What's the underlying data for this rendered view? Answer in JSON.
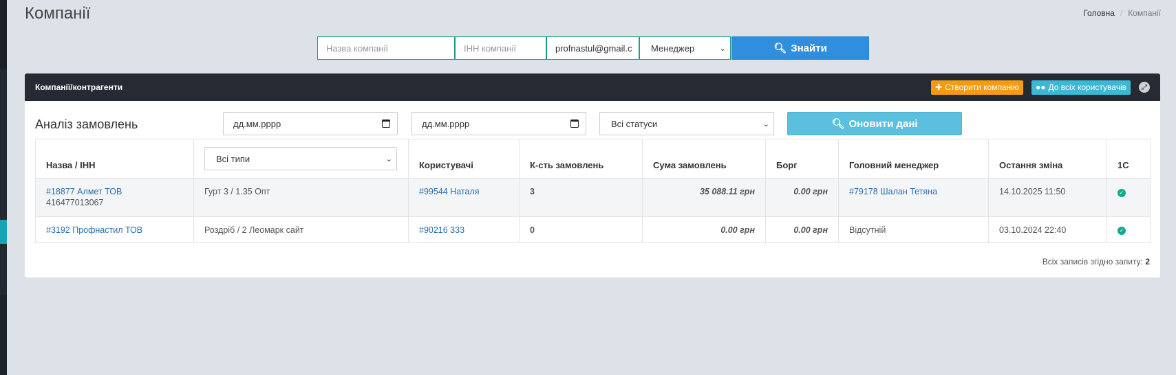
{
  "page": {
    "title": "Компанії"
  },
  "breadcrumb": {
    "home": "Головна",
    "separator": "/",
    "current": "Компанії"
  },
  "search": {
    "name_placeholder": "Назва компанії",
    "inn_placeholder": "ІНН компанії",
    "email_value": "profnastul@gmail.c",
    "manager_selected": "Менеджер",
    "find_label": "Знайти"
  },
  "panel": {
    "title": "Компанії/контрагенти",
    "create_label": "Створити компанію",
    "users_label": "До всіх користувачів"
  },
  "analysis": {
    "title": "Аналіз замовлень",
    "date_from_placeholder": "дд.мм.рррр",
    "date_to_placeholder": "дд.мм.рррр",
    "status_selected": "Всі статуси",
    "refresh_label": "Оновити дані",
    "type_selected": "Всі типи"
  },
  "table": {
    "headers": {
      "name": "Назва / ІНН",
      "users": "Користувачі",
      "orders_count": "К-сть замовлень",
      "orders_sum": "Сума замовлень",
      "debt": "Борг",
      "manager": "Головний менеджер",
      "last_change": "Остання зміна",
      "c1": "1С"
    },
    "rows": [
      {
        "name": "#18877 Алмет ТОВ",
        "inn": "416477013067",
        "type": "Гурт 3 / 1.35 Опт",
        "user": "#99544 Наталя",
        "count": "3",
        "sum": "35 088.11",
        "sum_currency": "грн",
        "debt": "0.00",
        "debt_currency": "грн",
        "manager": "#79178 Шалан Тетяна",
        "last_change": "14.10.2025 11:50",
        "c1": "check-circle-icon"
      },
      {
        "name": "#3192 Профнастил ТОВ",
        "inn": "",
        "type": "Роздріб / 2 Леомарк сайт",
        "user": "#90216 333",
        "count": "0",
        "sum": "0.00",
        "sum_currency": "грн",
        "debt": "0.00",
        "debt_currency": "грн",
        "manager": "Відсутній",
        "last_change": "03.10.2024 22:40",
        "c1": "check-circle-icon"
      }
    ]
  },
  "footer": {
    "total_label": "Всіх записів згідно запиту:",
    "total_value": "2"
  },
  "colors": {
    "accent": "#2f8fde",
    "create": "#f39c12",
    "info": "#5bc0de",
    "success": "#14a88c",
    "header_dark": "#262b33"
  }
}
